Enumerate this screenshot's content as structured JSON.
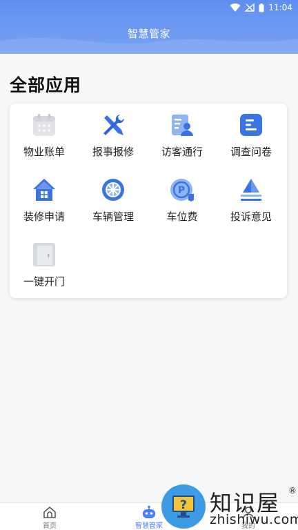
{
  "status_bar": {
    "time": "11:04"
  },
  "header": {
    "title": "智慧管家"
  },
  "section": {
    "title": "全部应用"
  },
  "apps": [
    {
      "label": "物业账单",
      "icon": "calendar-icon"
    },
    {
      "label": "报事报修",
      "icon": "tools-icon"
    },
    {
      "label": "访客通行",
      "icon": "visitor-icon"
    },
    {
      "label": "调查问卷",
      "icon": "survey-icon"
    },
    {
      "label": "装修申请",
      "icon": "house-icon"
    },
    {
      "label": "车辆管理",
      "icon": "wheel-icon"
    },
    {
      "label": "车位费",
      "icon": "parking-icon"
    },
    {
      "label": "投诉意见",
      "icon": "complaint-icon"
    },
    {
      "label": "一键开门",
      "icon": "door-icon"
    }
  ],
  "tabbar": {
    "tabs": [
      {
        "label": "首页",
        "icon": "home-icon",
        "active": false
      },
      {
        "label": "智慧管家",
        "icon": "robot-icon",
        "active": true
      },
      {
        "label": "我的",
        "icon": "user-icon",
        "active": false
      }
    ]
  },
  "watermark": {
    "title": "知识屋",
    "reg": "®",
    "domain": "zhishiwu.com"
  },
  "colors": {
    "primary": "#4b7ef0",
    "header": "#6a97f2"
  }
}
